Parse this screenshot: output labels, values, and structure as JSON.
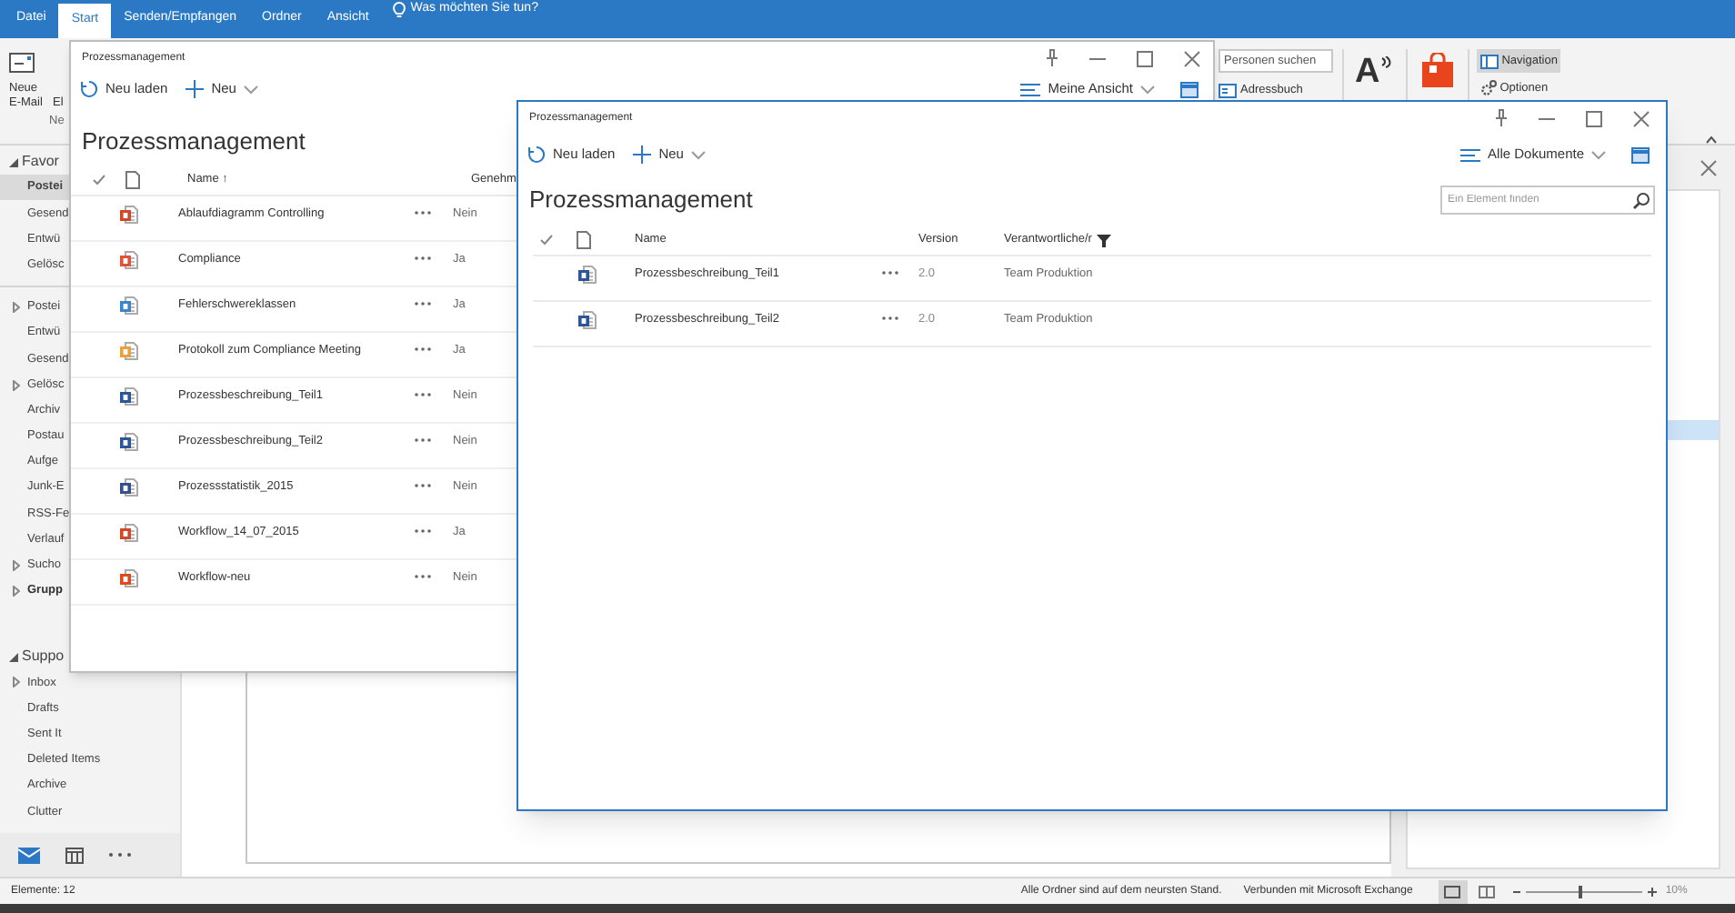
{
  "ribbon": {
    "tabs": [
      {
        "label": "Datei",
        "selected": false
      },
      {
        "label": "Start",
        "selected": true
      },
      {
        "label": "Senden/Empfangen",
        "selected": false
      },
      {
        "label": "Ordner",
        "selected": false
      },
      {
        "label": "Ansicht",
        "selected": false
      }
    ],
    "tell_me": "Was möchten Sie tun?",
    "new_email": "Neue E-Mail",
    "cut_button": "El",
    "cut_group": "Ne",
    "people_search": {
      "placeholder": "Personen suchen"
    },
    "address_book": "Adressbuch",
    "read_aloud_glyph": "A",
    "navigation": {
      "label": "Navigation",
      "selected": true
    },
    "options": "Optionen"
  },
  "folder_pane": {
    "sections": [
      {
        "items": [
          {
            "label": "Favor",
            "kind": "section",
            "selected": false
          },
          {
            "label": "Postei",
            "kind": "folder",
            "selected": true
          },
          {
            "label": "Gesend",
            "kind": "folder",
            "selected": false
          },
          {
            "label": "Entwü",
            "kind": "folder",
            "selected": false
          },
          {
            "label": "Gelösc",
            "kind": "folder",
            "selected": false
          }
        ]
      },
      {
        "items": [
          {
            "label": "Postei",
            "kind": "collapsed",
            "selected": false
          },
          {
            "label": "Entwü",
            "kind": "folder",
            "selected": false
          },
          {
            "label": "Gesend",
            "kind": "folder",
            "selected": false
          },
          {
            "label": "Gelösc",
            "kind": "collapsed",
            "selected": false
          },
          {
            "label": "Archiv",
            "kind": "folder",
            "selected": false
          },
          {
            "label": "Postau",
            "kind": "folder",
            "selected": false
          },
          {
            "label": "Aufge",
            "kind": "folder",
            "selected": false
          },
          {
            "label": "Junk-E",
            "kind": "folder",
            "selected": false
          },
          {
            "label": "RSS-Fe",
            "kind": "folder",
            "selected": false
          },
          {
            "label": "Verlauf",
            "kind": "folder",
            "selected": false
          },
          {
            "label": "Sucho",
            "kind": "collapsed",
            "selected": false
          },
          {
            "label": "Grupp",
            "kind": "group",
            "selected": false
          }
        ]
      },
      {
        "items": [
          {
            "label": "Suppo",
            "kind": "section",
            "selected": false
          },
          {
            "label": "Inbox",
            "kind": "collapsed",
            "selected": false
          },
          {
            "label": "Drafts",
            "kind": "folder",
            "selected": false
          },
          {
            "label": "Sent It",
            "kind": "folder",
            "selected": false
          },
          {
            "label": "Deleted Items",
            "kind": "folder",
            "selected": false
          },
          {
            "label": "Archive",
            "kind": "folder",
            "selected": false
          },
          {
            "label": "Clutter",
            "kind": "folder",
            "selected": false
          }
        ]
      }
    ]
  },
  "back_window": {
    "title": "Prozessmanagement",
    "refresh": "Neu laden",
    "new": "Neu",
    "view": "Meine Ansicht",
    "heading": "Prozessmanagement",
    "columns": [
      "Name ↑",
      "Genehm"
    ],
    "rows": [
      {
        "kind": "powerpoint",
        "name": "Ablaufdiagramm Controlling",
        "approved": "Nein"
      },
      {
        "kind": "chart",
        "name": "Compliance",
        "approved": "Ja"
      },
      {
        "kind": "image",
        "name": "Fehlerschwereklassen",
        "approved": "Ja"
      },
      {
        "kind": "email",
        "name": "Protokoll zum Compliance Meeting",
        "approved": "Ja"
      },
      {
        "kind": "word",
        "name": "Prozessbeschreibung_Teil1",
        "approved": "Nein"
      },
      {
        "kind": "word",
        "name": "Prozessbeschreibung_Teil2",
        "approved": "Nein"
      },
      {
        "kind": "visio",
        "name": "Prozessstatistik_2015",
        "approved": "Nein"
      },
      {
        "kind": "powerpoint",
        "name": "Workflow_14_07_2015",
        "approved": "Ja"
      },
      {
        "kind": "office",
        "name": "Workflow-neu",
        "approved": "Nein"
      }
    ]
  },
  "front_window": {
    "title": "Prozessmanagement",
    "refresh": "Neu laden",
    "new": "Neu",
    "view": "Alle Dokumente",
    "heading": "Prozessmanagement",
    "search": {
      "placeholder": "Ein Element finden"
    },
    "columns": [
      "Name",
      "Version",
      "Verantwortliche/r"
    ],
    "rows": [
      {
        "kind": "word",
        "name": "Prozessbeschreibung_Teil1",
        "version": "2.0",
        "owner": "Team Produktion"
      },
      {
        "kind": "word",
        "name": "Prozessbeschreibung_Teil2",
        "version": "2.0",
        "owner": "Team Produktion"
      }
    ]
  },
  "status_bar": {
    "items": "Elemente: 12",
    "sync": "Alle Ordner sind auf dem neursten Stand.",
    "connection": "Verbunden mit Microsoft Exchange",
    "zoom": {
      "level": 0.47,
      "label": "10%"
    }
  }
}
